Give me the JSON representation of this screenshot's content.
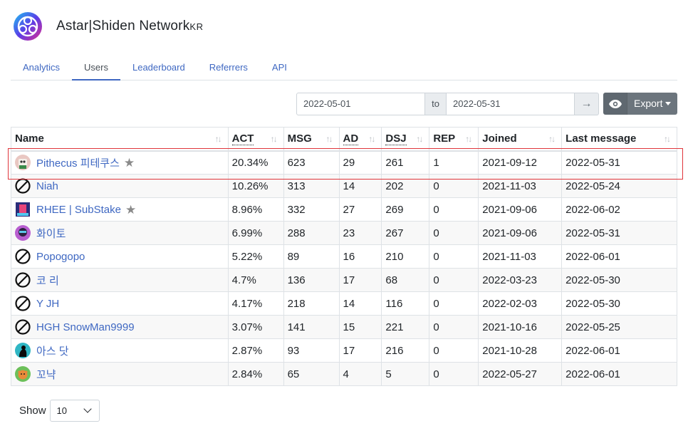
{
  "header": {
    "title": "Astar|Shiden Network",
    "title_suffix": "KR",
    "logo_icon": "astar-logo-icon"
  },
  "tabs": [
    {
      "label": "Analytics",
      "active": false
    },
    {
      "label": "Users",
      "active": true
    },
    {
      "label": "Leaderboard",
      "active": false
    },
    {
      "label": "Referrers",
      "active": false
    },
    {
      "label": "API",
      "active": false
    }
  ],
  "date_range": {
    "start": "2022-05-01",
    "separator": "to",
    "end": "2022-05-31",
    "go_icon": "→"
  },
  "toolbar": {
    "view_icon": "eye-icon",
    "export_label": "Export"
  },
  "table": {
    "columns": [
      {
        "label": "Name",
        "dotted": false
      },
      {
        "label": "ACT",
        "dotted": true
      },
      {
        "label": "MSG",
        "dotted": false
      },
      {
        "label": "AD",
        "dotted": true
      },
      {
        "label": "DSJ",
        "dotted": true
      },
      {
        "label": "REP",
        "dotted": false
      },
      {
        "label": "Joined",
        "dotted": false
      },
      {
        "label": "Last message",
        "dotted": false
      }
    ],
    "sort_icon": "↑↓",
    "rows": [
      {
        "name": "Pithecus 피테쿠스",
        "avatar": "avatar-pithecus",
        "starred": true,
        "act": "20.34%",
        "msg": "623",
        "ad": "29",
        "dsj": "261",
        "rep": "1",
        "joined": "2021-09-12",
        "last": "2022-05-31"
      },
      {
        "name": "Niah",
        "avatar": "no-avatar",
        "starred": false,
        "act": "10.26%",
        "msg": "313",
        "ad": "14",
        "dsj": "202",
        "rep": "0",
        "joined": "2021-11-03",
        "last": "2022-05-24"
      },
      {
        "name": "RHEE | SubStake",
        "avatar": "avatar-rhee",
        "starred": true,
        "act": "8.96%",
        "msg": "332",
        "ad": "27",
        "dsj": "269",
        "rep": "0",
        "joined": "2021-09-06",
        "last": "2022-06-02"
      },
      {
        "name": "화이토",
        "avatar": "avatar-white",
        "starred": false,
        "act": "6.99%",
        "msg": "288",
        "ad": "23",
        "dsj": "267",
        "rep": "0",
        "joined": "2021-09-06",
        "last": "2022-05-31"
      },
      {
        "name": "Popogopo",
        "avatar": "no-avatar",
        "starred": false,
        "act": "5.22%",
        "msg": "89",
        "ad": "16",
        "dsj": "210",
        "rep": "0",
        "joined": "2021-11-03",
        "last": "2022-06-01"
      },
      {
        "name": "코 리",
        "avatar": "no-avatar",
        "starred": false,
        "act": "4.7%",
        "msg": "136",
        "ad": "17",
        "dsj": "68",
        "rep": "0",
        "joined": "2022-03-23",
        "last": "2022-05-30"
      },
      {
        "name": "Y JH",
        "avatar": "no-avatar",
        "starred": false,
        "act": "4.17%",
        "msg": "218",
        "ad": "14",
        "dsj": "116",
        "rep": "0",
        "joined": "2022-02-03",
        "last": "2022-05-30"
      },
      {
        "name": "HGH SnowMan9999",
        "avatar": "no-avatar",
        "starred": false,
        "act": "3.07%",
        "msg": "141",
        "ad": "15",
        "dsj": "221",
        "rep": "0",
        "joined": "2021-10-16",
        "last": "2022-05-25"
      },
      {
        "name": "아스 닷",
        "avatar": "avatar-asdot",
        "starred": false,
        "act": "2.87%",
        "msg": "93",
        "ad": "17",
        "dsj": "216",
        "rep": "0",
        "joined": "2021-10-28",
        "last": "2022-06-01"
      },
      {
        "name": "꼬냑",
        "avatar": "avatar-kkonyak",
        "starred": false,
        "act": "2.84%",
        "msg": "65",
        "ad": "4",
        "dsj": "5",
        "rep": "0",
        "joined": "2022-05-27",
        "last": "2022-06-01"
      }
    ]
  },
  "pagination": {
    "show_label": "Show",
    "page_size": "10"
  },
  "colors": {
    "link": "#3f68c2",
    "highlight_border": "#e0353b",
    "button_secondary": "#6c757d"
  }
}
